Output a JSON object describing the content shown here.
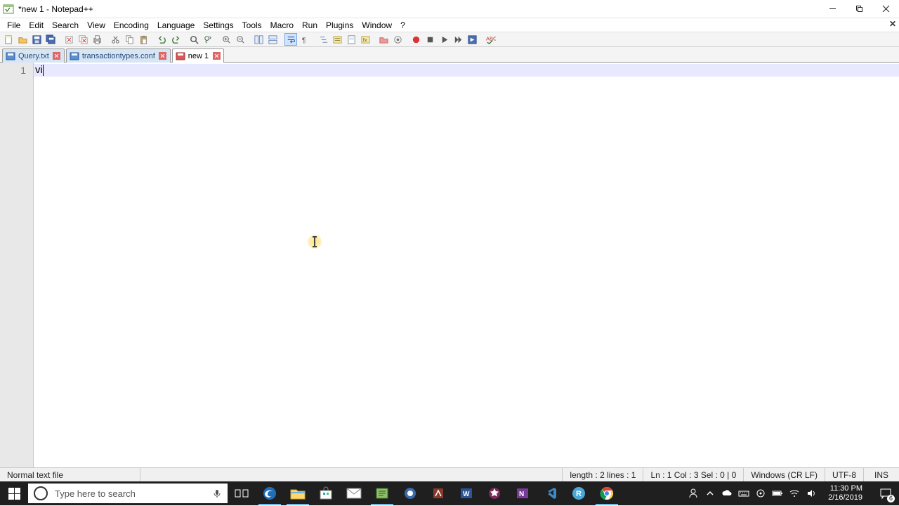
{
  "window": {
    "title": "*new 1 - Notepad++"
  },
  "menu": {
    "items": [
      "File",
      "Edit",
      "Search",
      "View",
      "Encoding",
      "Language",
      "Settings",
      "Tools",
      "Macro",
      "Run",
      "Plugins",
      "Window",
      "?"
    ]
  },
  "tabs": [
    {
      "label": "Query.txt",
      "modified": false,
      "active": false
    },
    {
      "label": "transactiontypes.conf",
      "modified": false,
      "active": false
    },
    {
      "label": "new 1",
      "modified": true,
      "active": true
    }
  ],
  "editor": {
    "line_numbers": [
      "1"
    ],
    "content": "vi",
    "caret_col": 3
  },
  "statusbar": {
    "filetype": "Normal text file",
    "length_lines": "length : 2    lines : 1",
    "position": "Ln : 1    Col : 3    Sel : 0 | 0",
    "eol": "Windows (CR LF)",
    "encoding": "UTF-8",
    "mode": "INS"
  },
  "taskbar": {
    "search_placeholder": "Type here to search",
    "clock_time": "11:30 PM",
    "clock_date": "2/16/2019",
    "notif_count": "6"
  },
  "colors": {
    "tab_inactive_bg": "#d6e6f5",
    "currentline": "#e8e8ff"
  }
}
